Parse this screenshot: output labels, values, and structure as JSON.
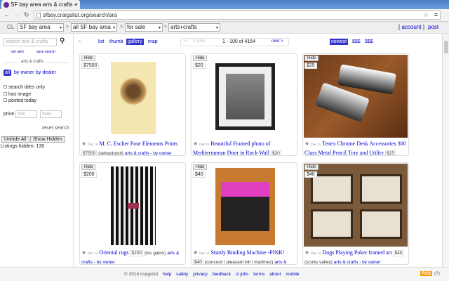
{
  "browser": {
    "tab_title": "SF bay area arts & crafts -",
    "url": "sfbay.craigslist.org/search/ara"
  },
  "clbar": {
    "cl": "CL",
    "area": "SF bay area",
    "subarea": "all SF bay area",
    "section": "for sale",
    "category": "arts+crafts",
    "account": "account",
    "post": "post"
  },
  "sidebar": {
    "search_placeholder": "search arts & crafts",
    "set_alert": "set alert",
    "save_search": "save search",
    "category_label": "arts & crafts",
    "seller": [
      "all",
      "by owner",
      "by dealer"
    ],
    "checks": [
      "search titles only",
      "has image",
      "posted today"
    ],
    "price_label": "price",
    "min": "min",
    "max": "max",
    "reset": "reset search",
    "unhide": "Unhide All",
    "show_hidden": "Show Hidden",
    "hidden_count": "Listings hidden: 130"
  },
  "toolbar": {
    "back": "←",
    "views": [
      "list",
      "thumb",
      "gallery",
      "map"
    ],
    "first": "<<",
    "prev": "< prev",
    "range": "1 - 100 of 4164",
    "next": "next >",
    "sorts": [
      "newest",
      "$$$",
      "$$$"
    ]
  },
  "listings": [
    {
      "hide": "Hide",
      "price": "$7500",
      "date": "Dec 10",
      "title": "M. C. Escher Four Elements Prints",
      "loc": "(sebastopol)",
      "cat": "arts & crafts - by owner"
    },
    {
      "hide": "Hide",
      "price": "$20",
      "date": "Dec 11",
      "title": "Beautiful Framed photo of Mediterranean Door in Rock Wall",
      "loc": "",
      "cat": ""
    },
    {
      "hide": "Hide",
      "price": "$25",
      "date": "Dec 11",
      "title": "Tenex Chrome Desk Accessories 300 Class Metal Pencil Tray and Utility",
      "loc": "",
      "cat": ""
    },
    {
      "hide": "Hide",
      "price": "$200",
      "date": "Dec 12",
      "title": "Oriental rugs",
      "loc": "(los gatos)",
      "cat": "arts & crafts - by owner"
    },
    {
      "hide": "Hide",
      "price": "$40",
      "date": "Dec 12",
      "title": "Sturdy Binding Machine -PINK!",
      "loc": "(concord / pleasant hill / martinez)",
      "cat": "arts &"
    },
    {
      "hide": "Hide",
      "price": "$40",
      "date": "Dec 12",
      "title": "Dogs Playing Poker framed art",
      "loc": "(scotts valley)",
      "cat": "arts & crafts - by owner"
    }
  ],
  "footer": {
    "copyright": "© 2014 craigslist",
    "links": [
      "help",
      "safety",
      "privacy",
      "feedback",
      "cl jobs",
      "terms",
      "about",
      "mobile"
    ],
    "rss": "RSS",
    "help_q": "(?)"
  }
}
